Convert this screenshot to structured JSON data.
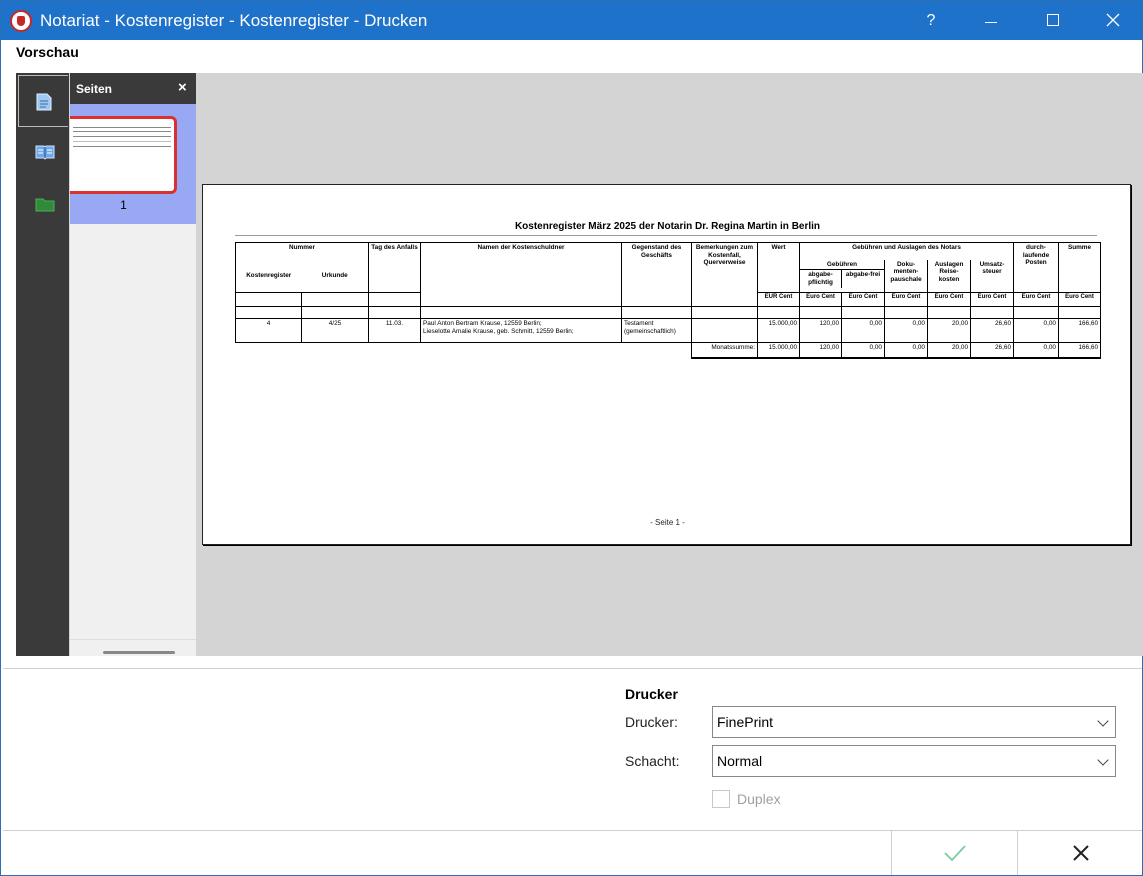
{
  "window": {
    "title": "Notariat - Kostenregister - Kostenregister - Drucken"
  },
  "titlebar": {
    "help": "?"
  },
  "preview": {
    "section_label": "Vorschau",
    "pages_panel": {
      "title": "Seiten",
      "close": "×",
      "thumbnail_number": "1"
    }
  },
  "document": {
    "title": "Kostenregister März 2025 der Notarin Dr. Regina Martin in Berlin",
    "footer": "- Seite 1 -",
    "headers": {
      "nummer": "Nummer",
      "kostenregister": "Kostenregister",
      "urkunde": "Urkunde",
      "tag": "Tag des Anfalls",
      "namen": "Namen der Kostenschuldner",
      "gegenstand": "Gegenstand des Geschäfts",
      "bemerkungen": "Bemerkungen zum Kostenfall, Querverweise",
      "wert": "Wert",
      "gebuehren_auslagen": "Gebühren und Auslagen des Notars",
      "gebuehren": "Gebühren",
      "abgabepflichtig": "abgabe-pflichtig",
      "abgabefrei": "abgabe-frei",
      "dokumentenpauschale": "Doku-menten-pauschale",
      "auslagen_reisekosten": "Auslagen Reise-kosten",
      "umsatzsteuer": "Umsatz-steuer",
      "durchlaufende": "durch-laufende Posten",
      "summe": "Summe",
      "eur_cent": "EUR Cent",
      "euro_cent": "Euro Cent"
    },
    "row": {
      "kostenregister": "4",
      "urkunde": "4/25",
      "tag": "11.03.",
      "namen_1": "Paul Anton Bertram Krause, 12559 Berlin;",
      "namen_2": "Lieselotte Amalie Krause, geb. Schmitt, 12559 Berlin;",
      "gegenstand_1": "Testament",
      "gegenstand_2": "(gemeinschaftlich)",
      "wert": "15.000,00",
      "abgabepflichtig": "120,00",
      "abgabefrei": "0,00",
      "dokumentenpauschale": "0,00",
      "auslagen": "20,00",
      "umsatzsteuer": "26,60",
      "durchlaufende": "0,00",
      "summe": "166,60"
    },
    "monthly": {
      "label": "Monatssumme:",
      "wert": "15.000,00",
      "abgabepflichtig": "120,00",
      "abgabefrei": "0,00",
      "dokumentenpauschale": "0,00",
      "auslagen": "20,00",
      "umsatzsteuer": "26,60",
      "durchlaufende": "0,00",
      "summe": "166,60"
    }
  },
  "printer": {
    "title": "Drucker",
    "printer_label": "Drucker:",
    "printer_value": "FinePrint",
    "tray_label": "Schacht:",
    "tray_value": "Normal",
    "duplex_label": "Duplex",
    "duplex_checked": false
  },
  "colors": {
    "titlebar": "#1f72c9",
    "thumb_selection": "#98a8f3",
    "thumb_border": "#d93030",
    "ok_check": "#7ec9a4"
  }
}
